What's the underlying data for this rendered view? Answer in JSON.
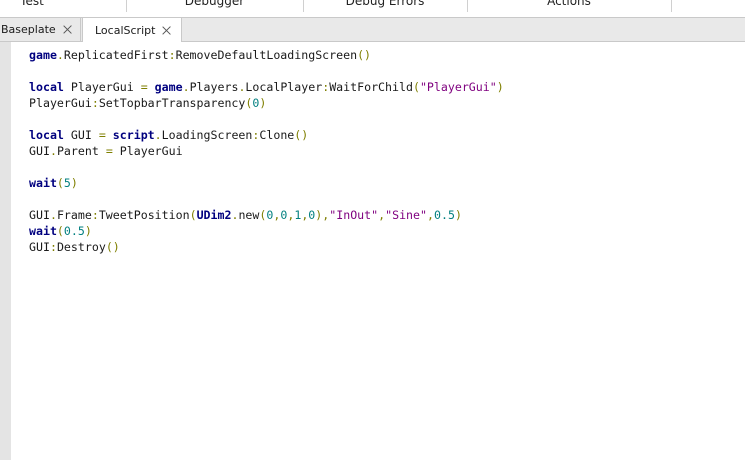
{
  "ribbon": {
    "sections": [
      {
        "label": "Test"
      },
      {
        "label": "Debugger"
      },
      {
        "label": "Debug Errors"
      },
      {
        "label": "Actions"
      }
    ]
  },
  "tabs": [
    {
      "label": "Baseplate",
      "active": false
    },
    {
      "label": "LocalScript",
      "active": true
    }
  ],
  "code_lines": [
    [
      [
        "global",
        "game"
      ],
      [
        "op",
        "."
      ],
      [
        "id",
        "ReplicatedFirst"
      ],
      [
        "op",
        ":"
      ],
      [
        "id",
        "RemoveDefaultLoadingScreen"
      ],
      [
        "op",
        "()"
      ]
    ],
    [],
    [
      [
        "kw",
        "local"
      ],
      [
        "id",
        " PlayerGui "
      ],
      [
        "op",
        "="
      ],
      [
        "id",
        " "
      ],
      [
        "global",
        "game"
      ],
      [
        "op",
        "."
      ],
      [
        "id",
        "Players"
      ],
      [
        "op",
        "."
      ],
      [
        "id",
        "LocalPlayer"
      ],
      [
        "op",
        ":"
      ],
      [
        "id",
        "WaitForChild"
      ],
      [
        "op",
        "("
      ],
      [
        "str",
        "\"PlayerGui\""
      ],
      [
        "op",
        ")"
      ]
    ],
    [
      [
        "id",
        "PlayerGui"
      ],
      [
        "op",
        ":"
      ],
      [
        "id",
        "SetTopbarTransparency"
      ],
      [
        "op",
        "("
      ],
      [
        "num",
        "0"
      ],
      [
        "op",
        ")"
      ]
    ],
    [],
    [
      [
        "kw",
        "local"
      ],
      [
        "id",
        " GUI "
      ],
      [
        "op",
        "="
      ],
      [
        "id",
        " "
      ],
      [
        "global",
        "script"
      ],
      [
        "op",
        "."
      ],
      [
        "id",
        "LoadingScreen"
      ],
      [
        "op",
        ":"
      ],
      [
        "id",
        "Clone"
      ],
      [
        "op",
        "()"
      ]
    ],
    [
      [
        "id",
        "GUI"
      ],
      [
        "op",
        "."
      ],
      [
        "id",
        "Parent "
      ],
      [
        "op",
        "="
      ],
      [
        "id",
        " PlayerGui"
      ]
    ],
    [],
    [
      [
        "global",
        "wait"
      ],
      [
        "op",
        "("
      ],
      [
        "num",
        "5"
      ],
      [
        "op",
        ")"
      ]
    ],
    [],
    [
      [
        "id",
        "GUI"
      ],
      [
        "op",
        "."
      ],
      [
        "id",
        "Frame"
      ],
      [
        "op",
        ":"
      ],
      [
        "id",
        "TweetPosition"
      ],
      [
        "op",
        "("
      ],
      [
        "global",
        "UDim2"
      ],
      [
        "op",
        "."
      ],
      [
        "id",
        "new"
      ],
      [
        "op",
        "("
      ],
      [
        "num",
        "0"
      ],
      [
        "op",
        ","
      ],
      [
        "num",
        "0"
      ],
      [
        "op",
        ","
      ],
      [
        "num",
        "1"
      ],
      [
        "op",
        ","
      ],
      [
        "num",
        "0"
      ],
      [
        "op",
        "),"
      ],
      [
        "str",
        "\"InOut\""
      ],
      [
        "op",
        ","
      ],
      [
        "str",
        "\"Sine\""
      ],
      [
        "op",
        ","
      ],
      [
        "num",
        "0.5"
      ],
      [
        "op",
        ")"
      ]
    ],
    [
      [
        "global",
        "wait"
      ],
      [
        "op",
        "("
      ],
      [
        "num",
        "0.5"
      ],
      [
        "op",
        ")"
      ]
    ],
    [
      [
        "id",
        "GUI"
      ],
      [
        "op",
        ":"
      ],
      [
        "id",
        "Destroy"
      ],
      [
        "op",
        "()"
      ]
    ]
  ]
}
